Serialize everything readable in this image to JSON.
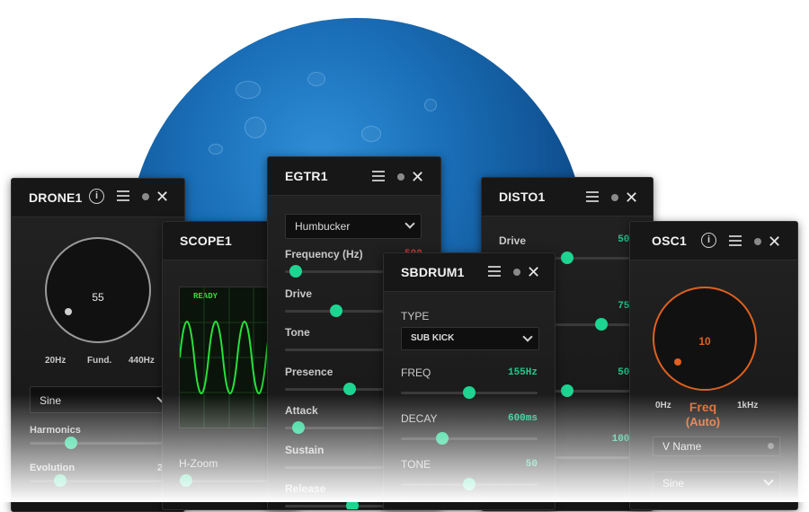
{
  "drone": {
    "title": "DRONE1",
    "knob_value": "55",
    "min": "20Hz",
    "mid": "Fund.",
    "max": "440Hz",
    "wave": "Sine",
    "harmonics": "Harmonics",
    "evolution": "Evolution",
    "evolution_value": "2"
  },
  "scope": {
    "title": "SCOPE1",
    "status": "READY",
    "hzoom": "H-Zoom"
  },
  "egtr": {
    "title": "EGTR1",
    "pickup": "Humbucker",
    "params": [
      {
        "label": "Frequency (Hz)",
        "value": "500",
        "level": 0.08
      },
      {
        "label": "Drive",
        "level": 0.38
      },
      {
        "label": "Tone",
        "level": 0.78
      },
      {
        "label": "Presence",
        "level": 0.48
      },
      {
        "label": "Attack",
        "level": 0.1
      },
      {
        "label": "Sustain",
        "level": 0.78
      },
      {
        "label": "Release",
        "level": 0.5
      }
    ]
  },
  "disto": {
    "title": "DISTO1",
    "drive_label": "Drive",
    "params": [
      {
        "value": "50%",
        "level": 0.5
      },
      {
        "value": "75%",
        "level": 0.75
      },
      {
        "value": "50%",
        "level": 0.5
      },
      {
        "value": "100%",
        "level": 1.0
      }
    ]
  },
  "sbdrum": {
    "title": "SBDRUM1",
    "type_label": "TYPE",
    "type": "SUB KICK",
    "params": [
      {
        "label": "FREQ",
        "value": "155Hz",
        "level": 0.5
      },
      {
        "label": "DECAY",
        "value": "600ms",
        "level": 0.3
      },
      {
        "label": "TONE",
        "value": "50",
        "level": 0.5
      }
    ]
  },
  "osc": {
    "title": "OSC1",
    "knob_value": "10",
    "min": "0Hz",
    "max": "1kHz",
    "freq_label": "Freq",
    "mode": "(Auto)",
    "name_field": "V Name",
    "wave": "Sine"
  },
  "colors": {
    "accent": "#1ed491",
    "orange": "#e0601f",
    "scope": "#27e03b"
  }
}
